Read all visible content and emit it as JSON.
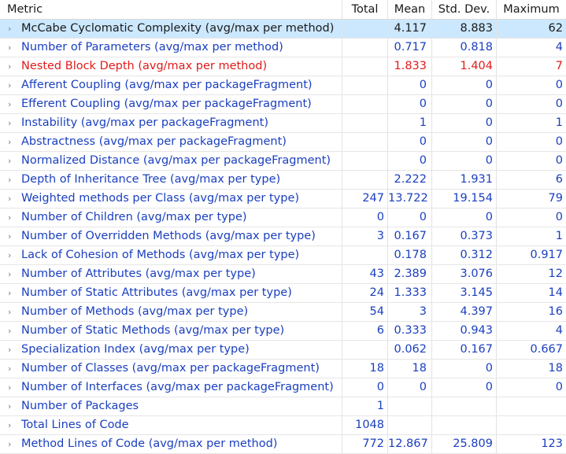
{
  "columns": [
    "Metric",
    "Total",
    "Mean",
    "Std. Dev.",
    "Maximum"
  ],
  "rows": [
    {
      "name": "McCabe Cyclomatic Complexity (avg/max per method)",
      "total": "",
      "mean": "4.117",
      "std": "8.883",
      "max": "62",
      "state": "selected"
    },
    {
      "name": "Number of Parameters (avg/max per method)",
      "total": "",
      "mean": "0.717",
      "std": "0.818",
      "max": "4",
      "state": "normal"
    },
    {
      "name": "Nested Block Depth (avg/max per method)",
      "total": "",
      "mean": "1.833",
      "std": "1.404",
      "max": "7",
      "state": "error"
    },
    {
      "name": "Afferent Coupling (avg/max per packageFragment)",
      "total": "",
      "mean": "0",
      "std": "0",
      "max": "0",
      "state": "normal"
    },
    {
      "name": "Efferent Coupling (avg/max per packageFragment)",
      "total": "",
      "mean": "0",
      "std": "0",
      "max": "0",
      "state": "normal"
    },
    {
      "name": "Instability (avg/max per packageFragment)",
      "total": "",
      "mean": "1",
      "std": "0",
      "max": "1",
      "state": "normal"
    },
    {
      "name": "Abstractness (avg/max per packageFragment)",
      "total": "",
      "mean": "0",
      "std": "0",
      "max": "0",
      "state": "normal"
    },
    {
      "name": "Normalized Distance (avg/max per packageFragment)",
      "total": "",
      "mean": "0",
      "std": "0",
      "max": "0",
      "state": "normal"
    },
    {
      "name": "Depth of Inheritance Tree (avg/max per type)",
      "total": "",
      "mean": "2.222",
      "std": "1.931",
      "max": "6",
      "state": "normal"
    },
    {
      "name": "Weighted methods per Class (avg/max per type)",
      "total": "247",
      "mean": "13.722",
      "std": "19.154",
      "max": "79",
      "state": "normal"
    },
    {
      "name": "Number of Children (avg/max per type)",
      "total": "0",
      "mean": "0",
      "std": "0",
      "max": "0",
      "state": "normal"
    },
    {
      "name": "Number of Overridden Methods (avg/max per type)",
      "total": "3",
      "mean": "0.167",
      "std": "0.373",
      "max": "1",
      "state": "normal"
    },
    {
      "name": "Lack of Cohesion of Methods (avg/max per type)",
      "total": "",
      "mean": "0.178",
      "std": "0.312",
      "max": "0.917",
      "state": "normal"
    },
    {
      "name": "Number of Attributes (avg/max per type)",
      "total": "43",
      "mean": "2.389",
      "std": "3.076",
      "max": "12",
      "state": "normal"
    },
    {
      "name": "Number of Static Attributes (avg/max per type)",
      "total": "24",
      "mean": "1.333",
      "std": "3.145",
      "max": "14",
      "state": "normal"
    },
    {
      "name": "Number of Methods (avg/max per type)",
      "total": "54",
      "mean": "3",
      "std": "4.397",
      "max": "16",
      "state": "normal"
    },
    {
      "name": "Number of Static Methods (avg/max per type)",
      "total": "6",
      "mean": "0.333",
      "std": "0.943",
      "max": "4",
      "state": "normal"
    },
    {
      "name": "Specialization Index (avg/max per type)",
      "total": "",
      "mean": "0.062",
      "std": "0.167",
      "max": "0.667",
      "state": "normal"
    },
    {
      "name": "Number of Classes (avg/max per packageFragment)",
      "total": "18",
      "mean": "18",
      "std": "0",
      "max": "18",
      "state": "normal"
    },
    {
      "name": "Number of Interfaces (avg/max per packageFragment)",
      "total": "0",
      "mean": "0",
      "std": "0",
      "max": "0",
      "state": "normal"
    },
    {
      "name": "Number of Packages",
      "total": "1",
      "mean": "",
      "std": "",
      "max": "",
      "state": "normal"
    },
    {
      "name": "Total Lines of Code",
      "total": "1048",
      "mean": "",
      "std": "",
      "max": "",
      "state": "normal"
    },
    {
      "name": "Method Lines of Code (avg/max per method)",
      "total": "772",
      "mean": "12.867",
      "std": "25.809",
      "max": "123",
      "state": "normal"
    }
  ],
  "icons": {
    "expand": "chevron-right-icon"
  },
  "colors": {
    "selected_bg": "#cce8ff",
    "link_text": "#1a3fbf",
    "error_text": "#e01b1b"
  }
}
